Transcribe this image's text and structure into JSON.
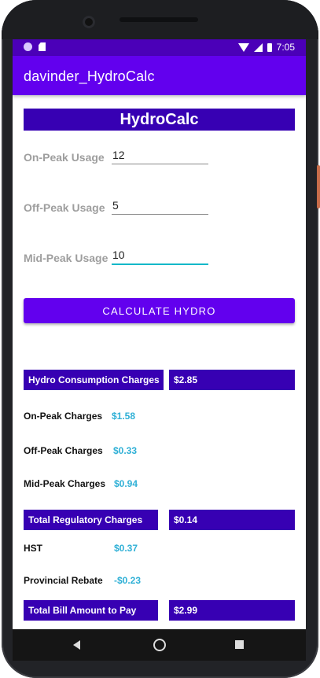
{
  "status_bar": {
    "time": "7:05",
    "icons": [
      "notification-dot-icon",
      "sd-card-icon",
      "wifi-icon",
      "signal-icon",
      "battery-icon"
    ]
  },
  "app_bar": {
    "title": "davinder_HydroCalc"
  },
  "header": {
    "title": "HydroCalc"
  },
  "inputs": {
    "on_peak": {
      "label": "On-Peak Usage",
      "value": "12"
    },
    "off_peak": {
      "label": "Off-Peak Usage",
      "value": "5"
    },
    "mid_peak": {
      "label": "Mid-Peak Usage",
      "value": "10"
    }
  },
  "calculate_button": {
    "label": "CALCULATE HYDRO"
  },
  "results": {
    "consumption": {
      "label": "Hydro Consumption Charges",
      "value": "$2.85"
    },
    "on_peak": {
      "label": "On-Peak Charges",
      "value": "$1.58"
    },
    "off_peak": {
      "label": "Off-Peak Charges",
      "value": "$0.33"
    },
    "mid_peak": {
      "label": "Mid-Peak Charges",
      "value": "$0.94"
    },
    "regulatory": {
      "label": "Total Regulatory Charges",
      "value": "$0.14"
    },
    "hst": {
      "label": "HST",
      "value": "$0.37"
    },
    "rebate": {
      "label": "Provincial Rebate",
      "value": "-$0.23"
    },
    "total": {
      "label": "Total Bill Amount to Pay",
      "value": "$2.99"
    }
  },
  "colors": {
    "primary": "#6200ee",
    "primary_dark": "#3700b3",
    "accent": "#2fb0d6"
  }
}
